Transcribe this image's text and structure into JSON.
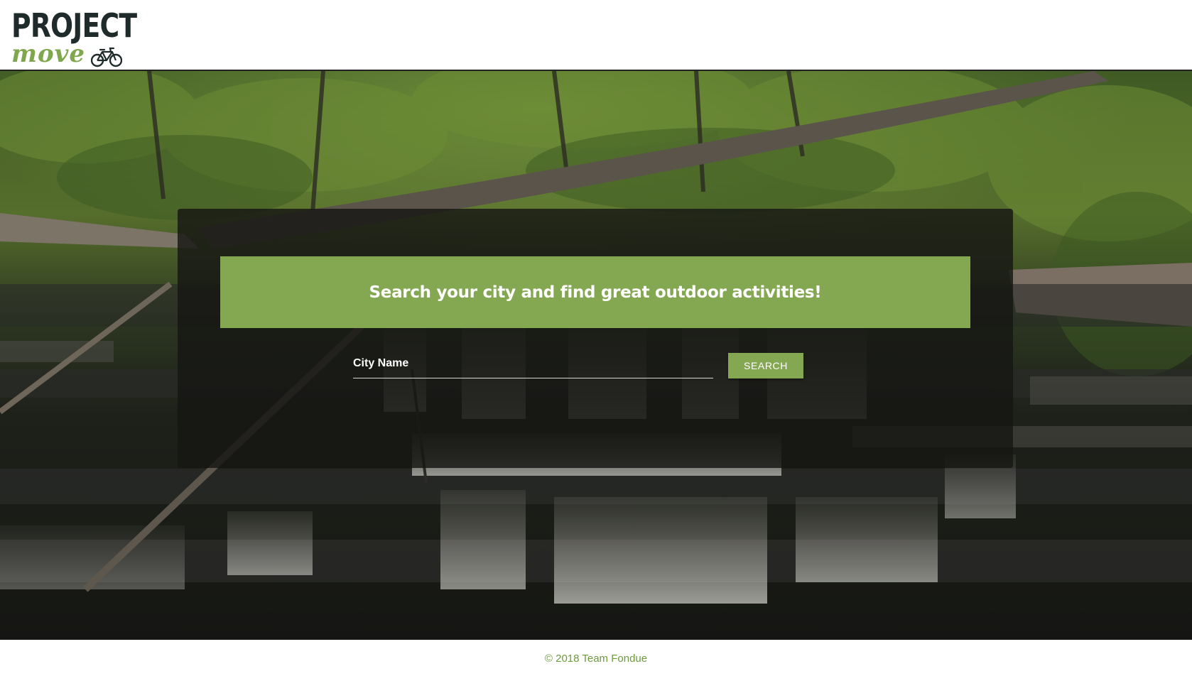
{
  "header": {
    "logo_primary": "PROJECT",
    "logo_secondary": "move",
    "logo_icon": "bicycle-icon"
  },
  "hero": {
    "background": "forest-waterfall-photo",
    "banner_text": "Search your city and find great outdoor activities!",
    "search": {
      "placeholder": "City Name",
      "value": "",
      "button_label": "SEARCH"
    }
  },
  "footer": {
    "copyright": "© 2018 Team Fondue"
  },
  "colors": {
    "accent": "#84a752",
    "logo_dark": "#1f2a2a",
    "footer_text": "#6e9a3e"
  }
}
